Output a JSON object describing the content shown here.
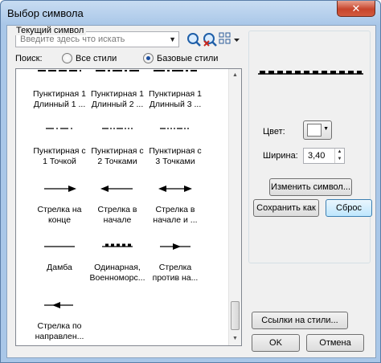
{
  "window": {
    "title": "Выбор символа",
    "close_glyph": "✕"
  },
  "search": {
    "placeholder": "Введите здесь что искать",
    "dropdown_glyph": "▼"
  },
  "search_scope": {
    "label": "Поиск:",
    "options": [
      {
        "label": "Все стили",
        "selected": false
      },
      {
        "label": "Базовые стили",
        "selected": true
      }
    ]
  },
  "symbols": [
    {
      "label_lines": [
        "Пунктирная 1",
        "Длинный 1 ..."
      ],
      "icon": "dash-long-1"
    },
    {
      "label_lines": [
        "Пунктирная 1",
        "Длинный 2 ..."
      ],
      "icon": "dash-long-2"
    },
    {
      "label_lines": [
        "Пунктирная 1",
        "Длинный 3 ..."
      ],
      "icon": "dash-long-3"
    },
    {
      "label_lines": [
        "Пунктирная с",
        "1 Точкой"
      ],
      "icon": "dash-dot-1"
    },
    {
      "label_lines": [
        "Пунктирная с",
        "2 Точками"
      ],
      "icon": "dash-dot-2"
    },
    {
      "label_lines": [
        "Пунктирная с",
        "3 Точками"
      ],
      "icon": "dash-dot-3"
    },
    {
      "label_lines": [
        "Стрелка на",
        "конце"
      ],
      "icon": "arrow-end"
    },
    {
      "label_lines": [
        "Стрелка в",
        "начале"
      ],
      "icon": "arrow-start"
    },
    {
      "label_lines": [
        "Стрелка в",
        "начале и ..."
      ],
      "icon": "arrow-both"
    },
    {
      "label_lines": [
        "Дамба"
      ],
      "icon": "dam-line"
    },
    {
      "label_lines": [
        "Одинарная,",
        "Военноморс..."
      ],
      "icon": "single-naval"
    },
    {
      "label_lines": [
        "Стрелка",
        "против на..."
      ],
      "icon": "arrow-against"
    },
    {
      "label_lines": [
        "Стрелка по",
        "направлен..."
      ],
      "icon": "arrow-along"
    }
  ],
  "current_symbol": {
    "legend": "Текущий символ",
    "color_label": "Цвет:",
    "color": "#ffffff",
    "width_label": "Ширина:",
    "width_value": "3,40"
  },
  "buttons": {
    "edit_symbol": "Изменить символ...",
    "save_as": "Сохранить как",
    "reset": "Сброс",
    "style_refs": "Ссылки на стили...",
    "ok": "OK",
    "cancel": "Отмена"
  },
  "colors": {
    "accent": "#1d4f9e",
    "list_border": "#828790"
  }
}
